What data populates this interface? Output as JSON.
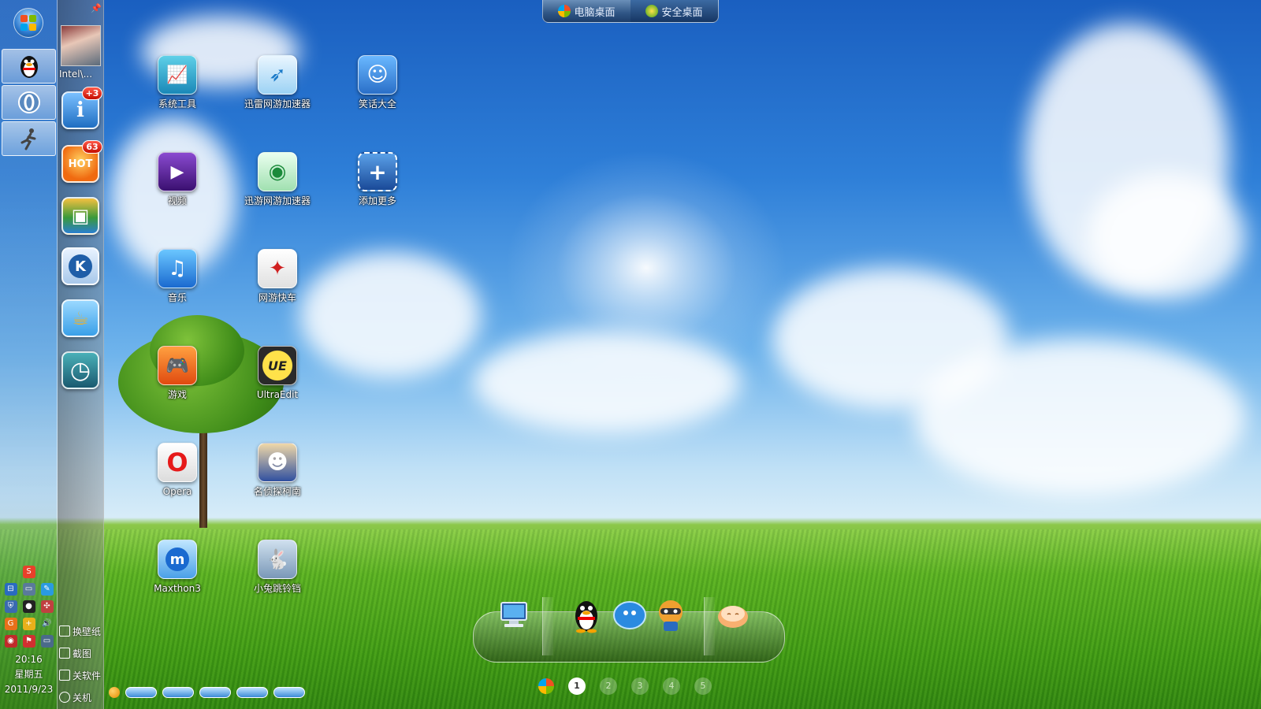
{
  "switcher": {
    "tabs": [
      {
        "label": "电脑桌面",
        "icon": "windows-flag-icon"
      },
      {
        "label": "安全桌面",
        "icon": "shield-icon"
      }
    ]
  },
  "user": {
    "name": "Intel\\..."
  },
  "dock": {
    "apps": [
      {
        "name": "info-app",
        "badge": "+3",
        "glyph": "i",
        "color": "#2c7fd0"
      },
      {
        "name": "hot-app",
        "badge": "63",
        "glyph": "HOT",
        "color": "#f07a1a"
      },
      {
        "name": "box-app",
        "badge": "",
        "glyph": "▣",
        "color": "#3a9a3a"
      },
      {
        "name": "kugou-app",
        "badge": "",
        "glyph": "K",
        "color": "#2a6bb0"
      },
      {
        "name": "teapot-app",
        "badge": "",
        "glyph": "☕",
        "color": "#f0a020"
      },
      {
        "name": "clock-app",
        "badge": "",
        "glyph": "◷",
        "color": "#2a7f8a"
      }
    ],
    "menu": [
      "换壁纸",
      "截图",
      "关软件",
      "关机"
    ]
  },
  "clock": {
    "time": "20:16",
    "weekday": "星期五",
    "date": "2011/9/23"
  },
  "desktop": {
    "icons": [
      {
        "label": "系统工具",
        "glyph": "📈",
        "color": "#27a3c9"
      },
      {
        "label": "迅雷网游加速器",
        "glyph": "➶",
        "color": "#4fb3e8"
      },
      {
        "label": "笑话大全",
        "glyph": "☺",
        "color": "#3a8fe0"
      },
      {
        "label": "视频",
        "glyph": "▶",
        "color": "#6a2aa0"
      },
      {
        "label": "迅游网游加速器",
        "glyph": "◉",
        "color": "#33a35a"
      },
      {
        "label": "添加更多",
        "glyph": "+",
        "color": "#2a6fc0"
      },
      {
        "label": "音乐",
        "glyph": "♫",
        "color": "#2a8be0"
      },
      {
        "label": "网游快车",
        "glyph": "✦",
        "color": "#e04040"
      },
      {
        "label": "游戏",
        "glyph": "🎮",
        "color": "#f06a10"
      },
      {
        "label": "UltraEdit",
        "glyph": "UE",
        "color": "#2a2a2a"
      },
      {
        "label": "Opera",
        "glyph": "O",
        "color": "#e61a1a"
      },
      {
        "label": "名侦探柯南",
        "glyph": "☻",
        "color": "#3050a0"
      },
      {
        "label": "Maxthon3",
        "glyph": "m",
        "color": "#2a8be0"
      },
      {
        "label": "小兔跳铃铛",
        "glyph": "🐇",
        "color": "#6a8aa8"
      }
    ]
  },
  "quickbar": {
    "items": [
      "computer-icon",
      "qq-penguin-icon",
      "chat-bubble-icon",
      "raccoon-icon",
      "egg-icon"
    ]
  },
  "pager": {
    "pages": [
      "1",
      "2",
      "3",
      "4",
      "5"
    ],
    "active": "1"
  },
  "colors": {
    "sky_top": "#1a5fc0",
    "grass": "#3f9a14",
    "badge": "#c40d00"
  }
}
